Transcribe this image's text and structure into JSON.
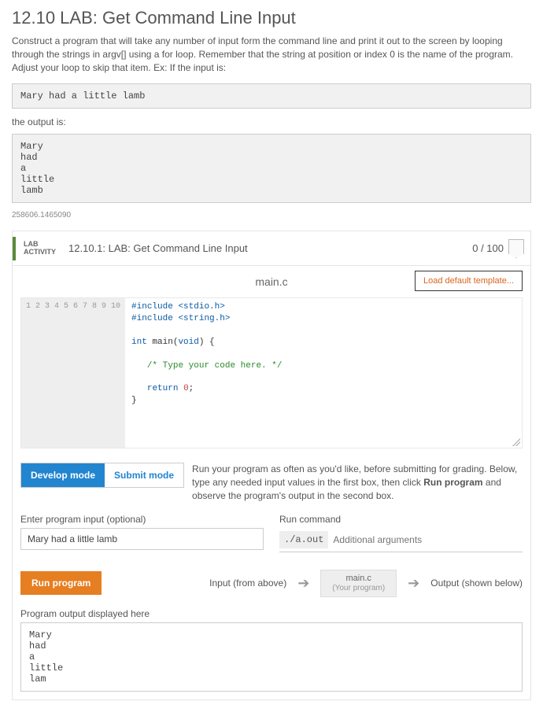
{
  "page_title": "12.10 LAB: Get Command Line Input",
  "instructions": "Construct a program that will take any number of input form the command line and print it out to the screen by looping through the strings in argv[] using a for loop. Remember that the string at position or index 0 is the name of the program. Adjust your loop to skip that item. Ex: If the input is:",
  "example_input": "Mary had a little lamb",
  "output_is_label": "the output is:",
  "example_output": "Mary\nhad\na\nlittle\nlamb",
  "small_id": "258606.1465090",
  "lab": {
    "flag_line1": "LAB",
    "flag_line2": "ACTIVITY",
    "title": "12.10.1: LAB: Get Command Line Input",
    "score": "0 / 100"
  },
  "file_name": "main.c",
  "load_template_label": "Load default template...",
  "gutter": "1\n2\n3\n4\n5\n6\n7\n8\n9\n10",
  "code": {
    "l1a": "#include",
    "l1b": " <stdio.h>",
    "l2a": "#include",
    "l2b": " <string.h>",
    "l4a": "int",
    "l4b": " main(",
    "l4c": "void",
    "l4d": ") {",
    "l6": "   /* Type your code here. */",
    "l8a": "   ",
    "l8b": "return",
    "l8c": " ",
    "l8d": "0",
    "l8e": ";",
    "l9": "}"
  },
  "modes": {
    "develop": "Develop mode",
    "submit": "Submit mode",
    "desc_pre": "Run your program as often as you'd like, before submitting for grading. Below, type any needed input values in the first box, then click ",
    "desc_bold": "Run program",
    "desc_post": " and observe the program's output in the second box."
  },
  "input_section": {
    "label": "Enter program input (optional)",
    "value": "Mary had a little lamb"
  },
  "run_section": {
    "label": "Run command",
    "fixed": "./a.out",
    "placeholder": "Additional arguments"
  },
  "exec": {
    "run_label": "Run program",
    "input_label": "Input (from above)",
    "stage_main": "main.c",
    "stage_sub": "(Your program)",
    "output_label": "Output (shown below)"
  },
  "program_output_label": "Program output displayed here",
  "program_output": "Mary\nhad\na\nlittle\nlam"
}
